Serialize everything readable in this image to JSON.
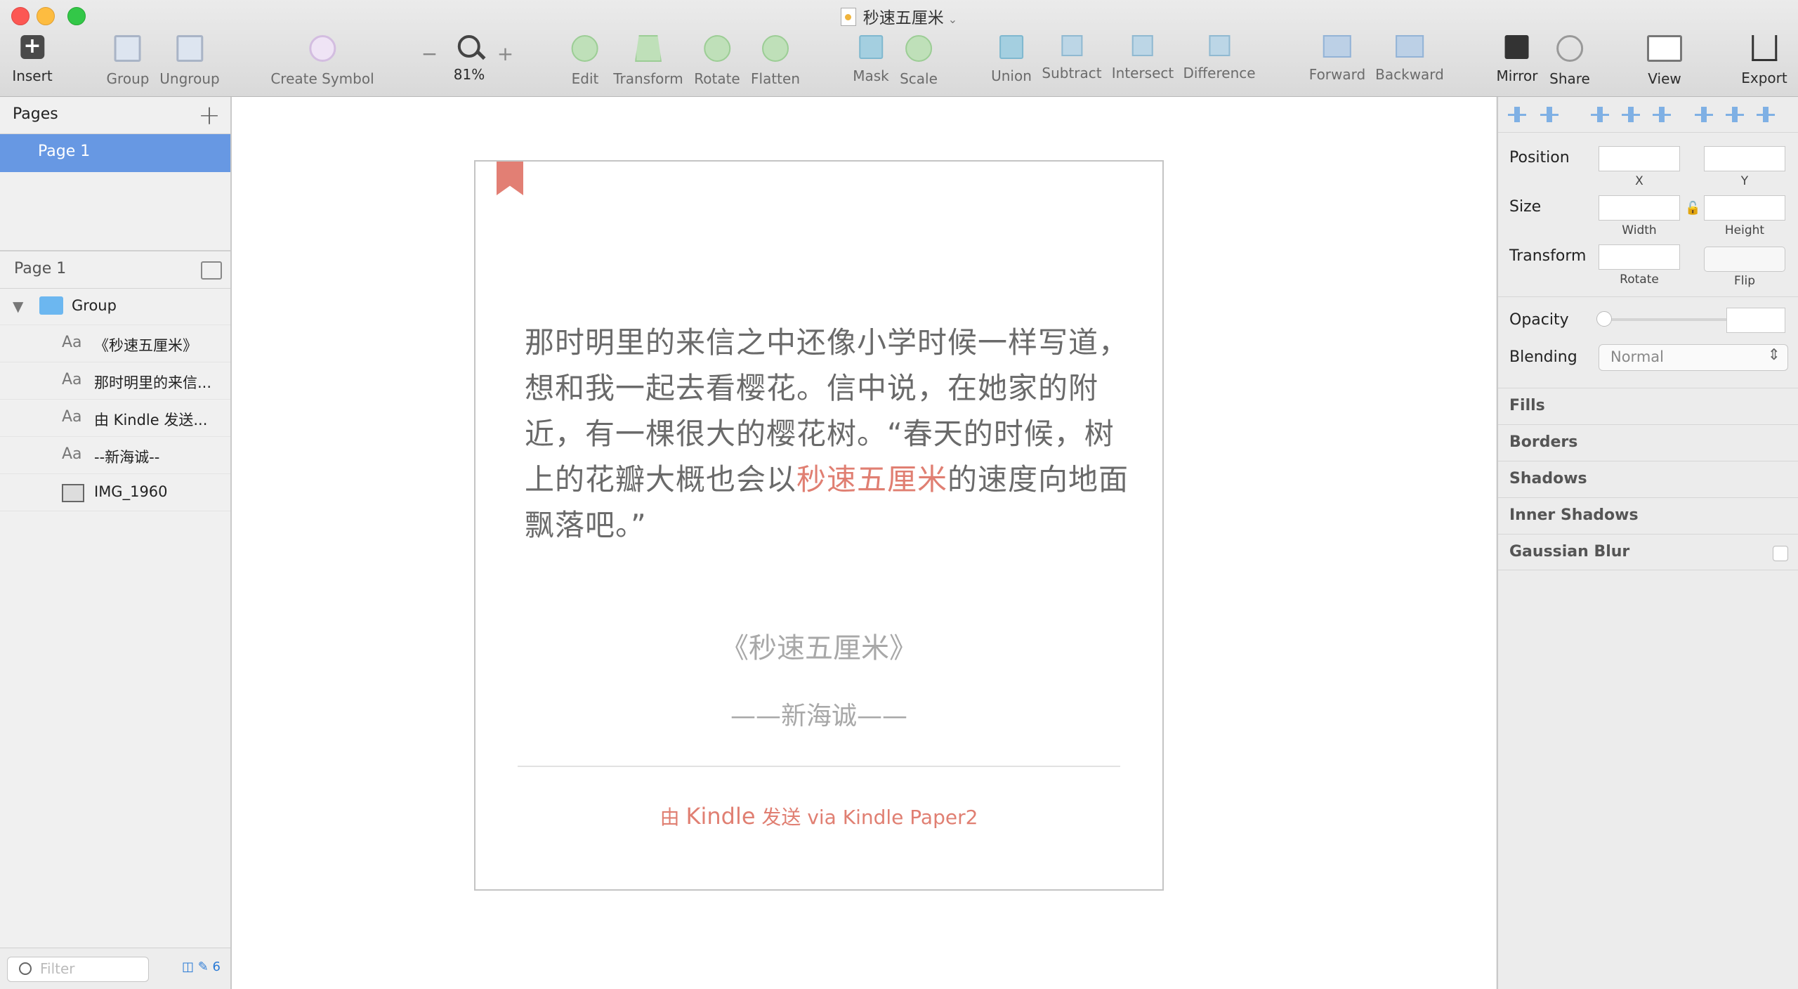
{
  "window": {
    "title": "秒速五厘米"
  },
  "toolbar": {
    "insert": "Insert",
    "group": "Group",
    "ungroup": "Ungroup",
    "create_symbol": "Create Symbol",
    "zoom_value": "81%",
    "zoom_minus": "−",
    "zoom_plus": "+",
    "edit": "Edit",
    "transform": "Transform",
    "rotate": "Rotate",
    "flatten": "Flatten",
    "mask": "Mask",
    "scale": "Scale",
    "union": "Union",
    "subtract": "Subtract",
    "intersect": "Intersect",
    "difference": "Difference",
    "forward": "Forward",
    "backward": "Backward",
    "mirror": "Mirror",
    "share": "Share",
    "view": "View",
    "export": "Export"
  },
  "sidebar": {
    "pages_title": "Pages",
    "add_icon": "+",
    "pages": [
      {
        "label": "Page 1",
        "selected": true
      }
    ],
    "layers_page": "Page 1",
    "group_name": "Group",
    "layers": [
      {
        "type": "text",
        "icon": "Aa",
        "label": "《秒速五厘米》"
      },
      {
        "type": "text",
        "icon": "Aa",
        "label": "那时明里的来信..."
      },
      {
        "type": "text",
        "icon": "Aa",
        "label": "由 Kindle 发送..."
      },
      {
        "type": "text",
        "icon": "Aa",
        "label": "--新海诚--"
      },
      {
        "type": "image",
        "icon": "image-icon",
        "label": "IMG_1960"
      }
    ],
    "filter_placeholder": "Filter",
    "filter_count": "6"
  },
  "artboard": {
    "quote_before": "那时明里的来信之中还像小学时候一样写道，想和我一起去看樱花。信中说，在她家的附近，有一棵很大的樱花树。“春天的时候，树上的花瓣大概也会以",
    "quote_highlight": "秒速五厘米",
    "quote_after": "的速度向地面飘落吧。”",
    "book_title": "《秒速五厘米》",
    "author": "——新海诚——",
    "footer_prefix": "由 ",
    "footer_brand": "Kindle",
    "footer_mid": " 发送 via Kindle Paper2",
    "accent": "#e07f72",
    "bookmark_color": "#e27f74"
  },
  "inspector": {
    "position_label": "Position",
    "x_label": "X",
    "y_label": "Y",
    "size_label": "Size",
    "width_label": "Width",
    "height_label": "Height",
    "transform_label": "Transform",
    "rotate_label": "Rotate",
    "flip_label": "Flip",
    "opacity_label": "Opacity",
    "blending_label": "Blending",
    "blending_value": "Normal",
    "fills": "Fills",
    "borders": "Borders",
    "shadows": "Shadows",
    "inner_shadows": "Inner Shadows",
    "gaussian_blur": "Gaussian Blur"
  }
}
